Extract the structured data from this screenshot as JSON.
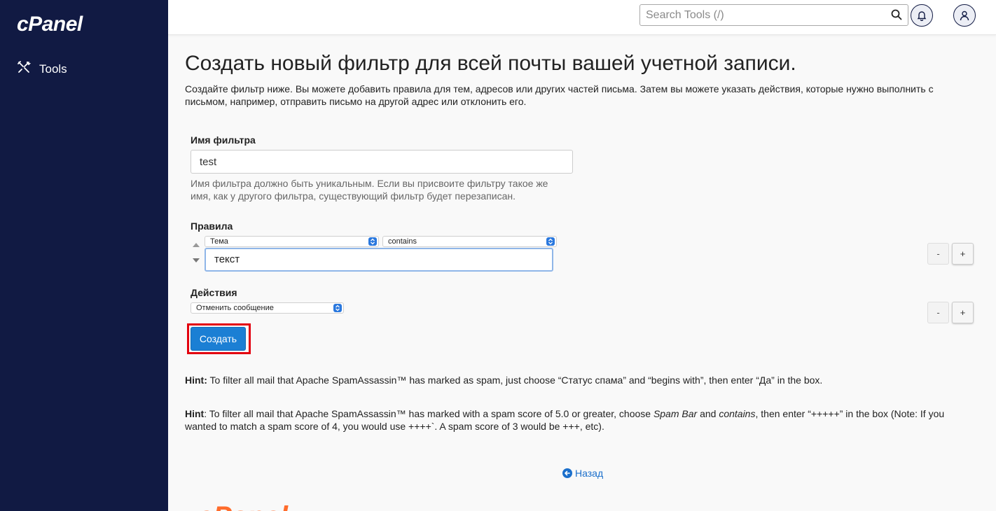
{
  "sidebar": {
    "logo": "cPanel",
    "nav": [
      {
        "label": "Tools",
        "icon": "tools-icon"
      }
    ]
  },
  "topbar": {
    "search_placeholder": "Search Tools (/)",
    "icons": [
      "search-icon",
      "bell-icon",
      "user-icon"
    ]
  },
  "page": {
    "title": "Создать новый фильтр для всей почты вашей учетной записи.",
    "description": "Создайте фильтр ниже. Вы можете добавить правила для тем, адресов или других частей письма. Затем вы можете указать действия, которые нужно выполнить с письмом, например, отправить письмо на другой адрес или отклонить его."
  },
  "filter_name": {
    "label": "Имя фильтра",
    "value": "test",
    "help": "Имя фильтра должно быть уникальным. Если вы присвоите фильтру такое же имя, как у другого фильтра, существующий фильтр будет перезаписан."
  },
  "rules": {
    "label": "Правила",
    "part_select": "Тема",
    "match_select": "contains",
    "value": "текст",
    "minus": "-",
    "plus": "+"
  },
  "actions": {
    "label": "Действия",
    "action_select": "Отменить сообщение",
    "minus": "-",
    "plus": "+"
  },
  "create_button": "Создать",
  "hints": [
    {
      "prefix": "Hint:",
      "text1": " To filter all mail that Apache SpamAssassin™ has marked as spam, just choose “Статус спама” and “begins with”, then enter “Да” in the box."
    },
    {
      "prefix": "Hint",
      "text1": ": To filter all mail that Apache SpamAssassin™ has marked with a spam score of 5.0 or greater, choose ",
      "em1": "Spam Bar",
      "text2": " and ",
      "em2": "contains",
      "text3": ", then enter “+++++” in the box (Note: If you wanted to match a spam score of 4, you would use ++++`. A spam score of 3 would be +++, etc)."
    }
  ],
  "back_link": "Назад",
  "footer_logo": "cPanel",
  "colors": {
    "sidebar_bg": "#111a43",
    "primary_button": "#1b7fd4",
    "highlight_box": "#e3000f",
    "link": "#1b6fcb",
    "footer_logo": "#ff6c2c"
  }
}
